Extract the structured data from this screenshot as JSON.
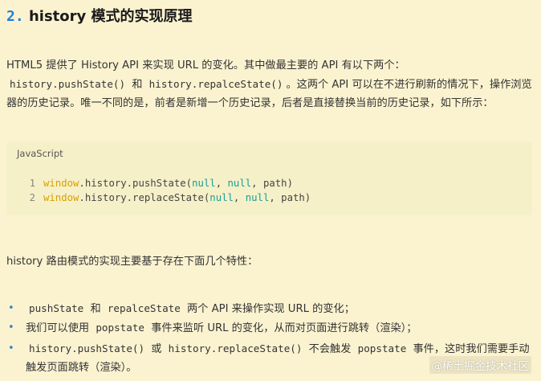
{
  "heading": {
    "number": "2.",
    "title": "history 模式的实现原理"
  },
  "intro": {
    "text1": "HTML5 提供了 History API 来实现 URL 的变化。其中做最主要的 API 有以下两个：",
    "code_push": "history.pushState()",
    "and": "和",
    "code_replace": "history.repalceState()",
    "text2": "。这两个 API 可以在不进行刷新的情况下，操作浏览器的历史记录。唯一不同的是，前者是新增一个历史记录，后者是直接替换当前的历史记录，如下所示："
  },
  "code_block": {
    "language": "JavaScript",
    "lines": [
      {
        "number": "1",
        "obj": "window",
        "method": ".history.pushState(",
        "arg1": "null",
        "sep1": ", ",
        "arg2": "null",
        "rest": ", path)"
      },
      {
        "number": "2",
        "obj": "window",
        "method": ".history.replaceState(",
        "arg1": "null",
        "sep1": ", ",
        "arg2": "null",
        "rest": ", path)"
      }
    ]
  },
  "features_intro": "history 路由模式的实现主要基于存在下面几个特性：",
  "bullets": [
    {
      "code1": "pushState",
      "and": "和",
      "code2": "repalceState",
      "text": "两个 API 来操作实现 URL 的变化；"
    },
    {
      "text1": "我们可以使用",
      "code1": "popstate",
      "text2": "事件来监听 URL 的变化，从而对页面进行跳转（渲染）；"
    },
    {
      "code1": "history.pushState()",
      "or": "或",
      "code2": "history.replaceState()",
      "text1": "不会触发",
      "code3": "popstate",
      "text2": "事件，这时我们需要手动触发页面跳转（渲染）。"
    }
  ],
  "watermark": "@稀土掘金技术社区",
  "colors": {
    "background": "#fbf3d0",
    "code_background": "#f6f0c9",
    "heading_number": "#1e80d8",
    "bullet": "#3a86c8",
    "code_variable": "#d9a000",
    "code_keyword": "#159f95"
  }
}
